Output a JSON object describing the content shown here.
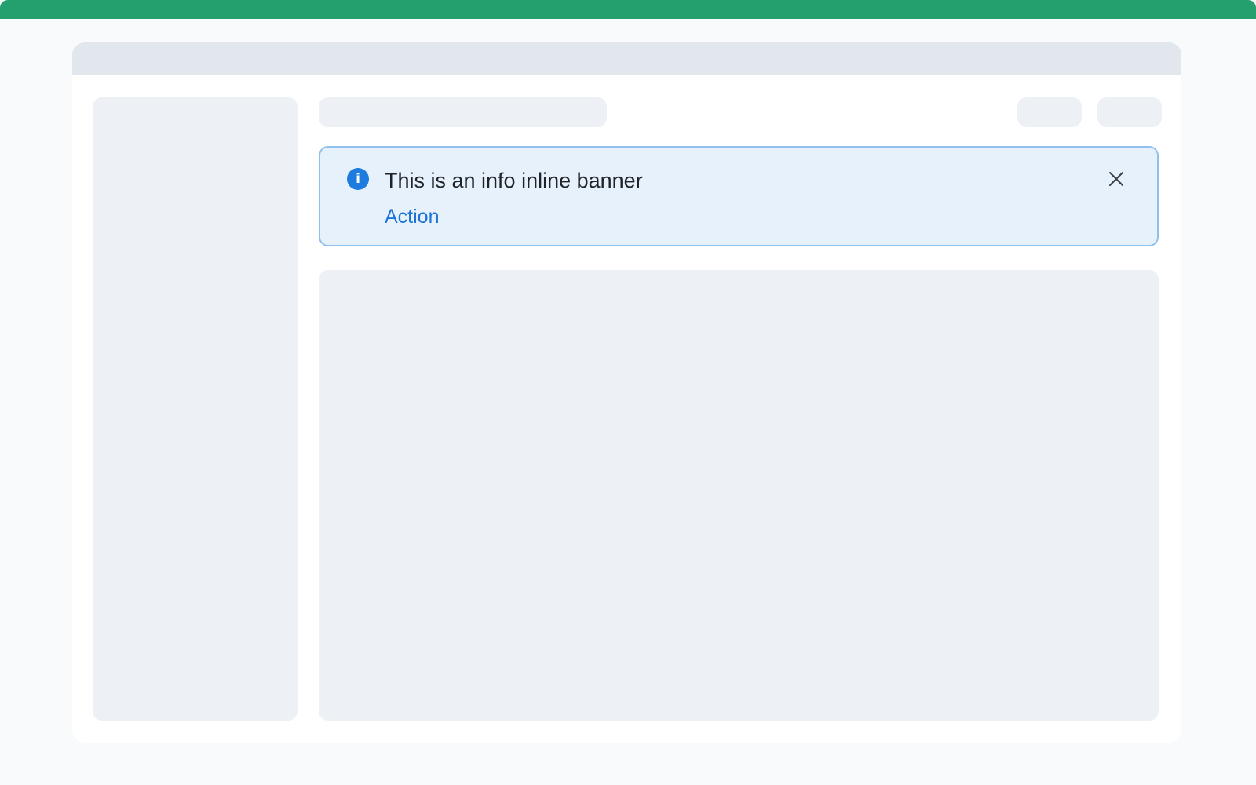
{
  "banner": {
    "message": "This is an info inline banner",
    "action_label": "Action",
    "icon": "info-icon",
    "close_icon": "close-icon"
  },
  "colors": {
    "top_accent": "#23a06d",
    "banner_background": "#e6f1fb",
    "banner_border": "#8ec1ee",
    "info_icon": "#1e7be0",
    "action_link": "#1d74d6",
    "placeholder": "#edf0f4",
    "titlebar": "#e2e6ed"
  }
}
